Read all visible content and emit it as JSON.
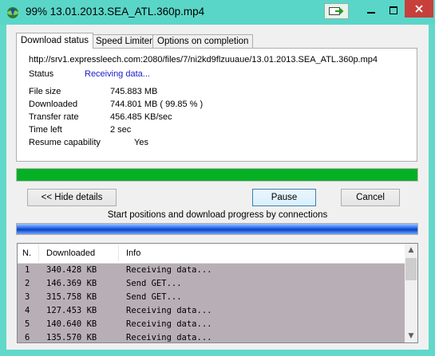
{
  "window": {
    "title": "99% 13.01.2013.SEA_ATL.360p.mp4"
  },
  "tabs": [
    "Download status",
    "Speed Limiter",
    "Options on completion"
  ],
  "status": {
    "url": "http://srv1.expressleech.com:2080/files/7/ni2kd9flzuuaue/13.01.2013.SEA_ATL.360p.mp4",
    "status_label": "Status",
    "status_value": "Receiving data...",
    "rows": [
      {
        "label": "File size",
        "value": "745.883  MB"
      },
      {
        "label": "Downloaded",
        "value": "744.801  MB  ( 99.85 % )"
      },
      {
        "label": "Transfer rate",
        "value": "456.485  KB/sec"
      },
      {
        "label": "Time left",
        "value": "2 sec"
      },
      {
        "label": "Resume capability",
        "value": "Yes"
      }
    ]
  },
  "progress": {
    "fraction": 0.9985
  },
  "buttons": {
    "hide_details": "<< Hide details",
    "pause": "Pause",
    "cancel": "Cancel"
  },
  "connections": {
    "title": "Start positions and download progress by connections",
    "columns": [
      "N.",
      "Downloaded",
      "Info"
    ],
    "rows": [
      {
        "n": "1",
        "downloaded": "340.428  KB",
        "info": "Receiving data..."
      },
      {
        "n": "2",
        "downloaded": "146.369  KB",
        "info": "Send GET..."
      },
      {
        "n": "3",
        "downloaded": "315.758  KB",
        "info": "Send GET..."
      },
      {
        "n": "4",
        "downloaded": "127.453  KB",
        "info": "Receiving data..."
      },
      {
        "n": "5",
        "downloaded": "140.640  KB",
        "info": "Receiving data..."
      },
      {
        "n": "6",
        "downloaded": "135.570  KB",
        "info": "Receiving data..."
      }
    ]
  },
  "colors": {
    "progress_green": "#06b025",
    "titlebar": "#5ad6c8",
    "row_bg": "#b8afb6",
    "status_value": "#1a1acd"
  },
  "icons": [
    "idm-app-icon",
    "green-arrow-icon",
    "minimize-icon",
    "maximize-icon",
    "close-icon",
    "scroll-up-icon",
    "scroll-down-icon"
  ]
}
